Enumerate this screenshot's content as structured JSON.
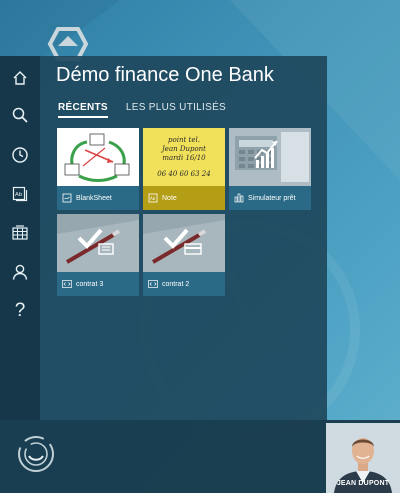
{
  "app": {
    "title": "Démo finance One Bank"
  },
  "tabs": [
    {
      "label": "RÉCENTS",
      "active": true
    },
    {
      "label": "LES PLUS UTILISÉS",
      "active": false
    }
  ],
  "sidebar": {
    "items": [
      {
        "name": "home-icon"
      },
      {
        "name": "search-icon"
      },
      {
        "name": "clock-icon"
      },
      {
        "name": "document-icon"
      },
      {
        "name": "grid-icon"
      },
      {
        "name": "user-icon"
      },
      {
        "name": "help-icon",
        "glyph": "?"
      }
    ]
  },
  "tiles": [
    {
      "label": "BlankSheet",
      "icon": "sheet-icon",
      "color": "#2a6a86"
    },
    {
      "label": "Note",
      "icon": "note-icon",
      "color": "#b49e16",
      "note_lines": [
        "point tel.",
        "Jean Dupont",
        "mardi 16/10",
        "06 40 60 63 24"
      ]
    },
    {
      "label": "Simulateur prêt",
      "icon": "bar-chart-icon",
      "color": "#2a6a86"
    },
    {
      "label": "contrat 3",
      "icon": "code-icon",
      "color": "#2a6a86"
    },
    {
      "label": "contrat 2",
      "icon": "code-icon",
      "color": "#2a6a86"
    }
  ],
  "profile": {
    "name": "JEAN DUPONT"
  },
  "colors": {
    "panel": "#1e485c",
    "rail": "#163748",
    "tile_caption": "#2a6a86",
    "note_yellow": "#f1e15a",
    "note_caption": "#b49e16"
  }
}
